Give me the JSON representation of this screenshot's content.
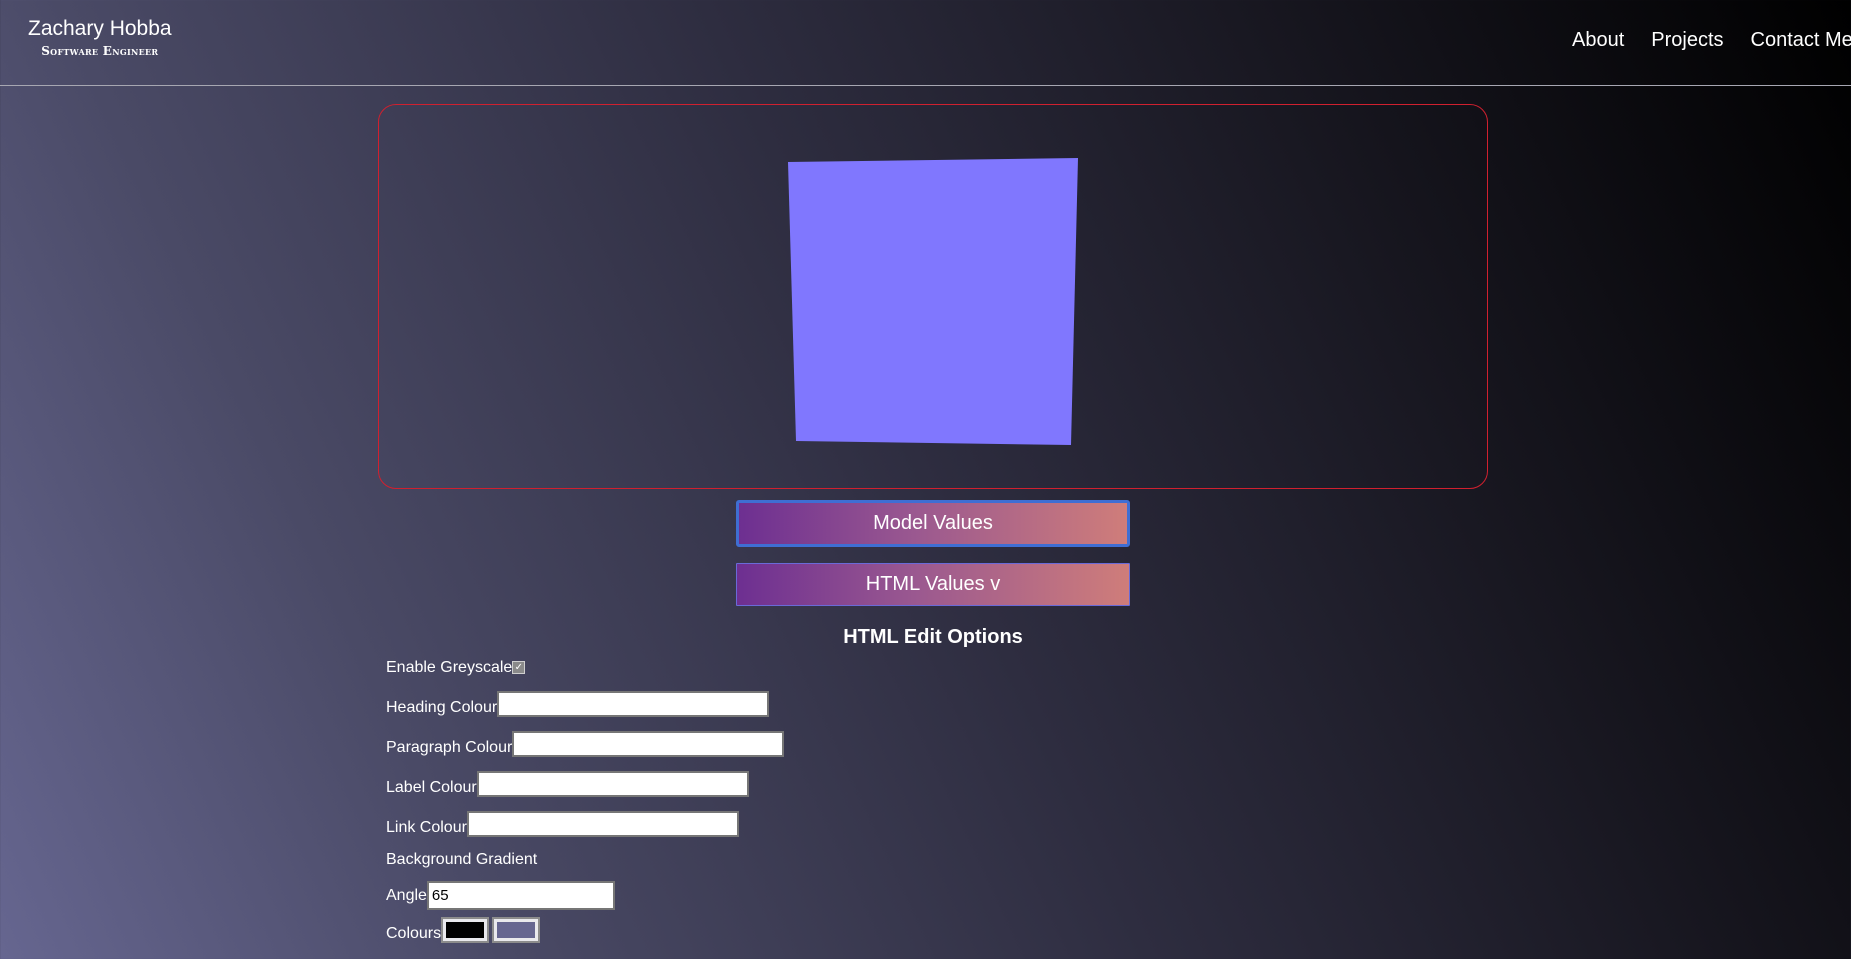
{
  "header": {
    "name": "Zachary Hobba",
    "role": "Software Engineer",
    "nav": [
      "About",
      "Projects",
      "Contact Me"
    ]
  },
  "viewer": {
    "cube_color": "#8077fe",
    "border_color": "#d0202f"
  },
  "buttons": {
    "model_values": "Model Values",
    "html_values": "HTML Values v"
  },
  "options": {
    "title": "HTML Edit Options",
    "enable_greyscale_label": "Enable Greyscale",
    "enable_greyscale_checked": true,
    "heading_colour_label": "Heading Colour",
    "heading_colour_value": "",
    "paragraph_colour_label": "Paragraph Colour",
    "paragraph_colour_value": "",
    "label_colour_label": "Label Colour",
    "label_colour_value": "",
    "link_colour_label": "Link Colour",
    "link_colour_value": "",
    "background_gradient_label": "Background Gradient",
    "angle_label": "Angle",
    "angle_value": "65",
    "colours_label": "Colours",
    "colours": [
      "#000000",
      "#666690"
    ]
  }
}
